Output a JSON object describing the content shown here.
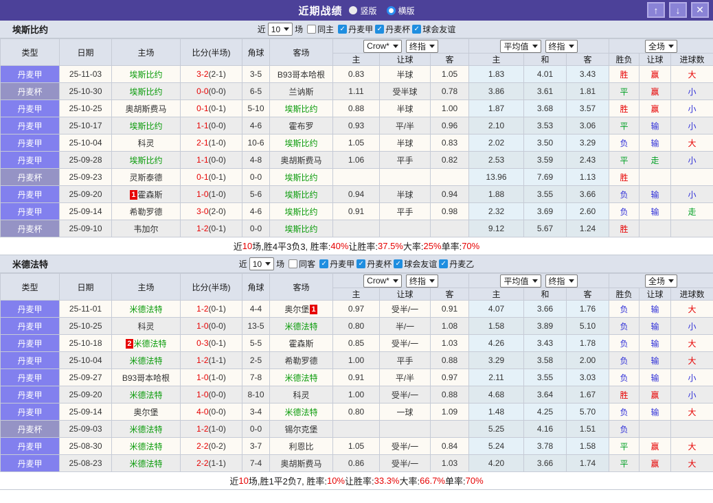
{
  "titlebar": {
    "title": "近期战绩",
    "radios": [
      {
        "label": "竖版",
        "selected": false
      },
      {
        "label": "横版",
        "selected": true
      }
    ],
    "icons": {
      "up": "↑",
      "down": "↓",
      "close": "✕"
    }
  },
  "labels": {
    "near": "近",
    "games": "场"
  },
  "selects": {
    "odds_source": "Crow*",
    "odds_mode": "终指",
    "avg_source": "平均值",
    "avg_mode": "终指",
    "scope": "全场"
  },
  "columns": {
    "type": "类型",
    "date": "日期",
    "home": "主场",
    "score": "比分(半场)",
    "corner": "角球",
    "away": "客场",
    "odds_home": "主",
    "odds_handicap": "让球",
    "odds_away": "客",
    "avg_home": "主",
    "avg_draw": "和",
    "avg_away": "客",
    "result": "胜负",
    "handicap_result": "让球",
    "goals": "进球数"
  },
  "sections": [
    {
      "team": "埃斯比约",
      "filter": {
        "count": "10",
        "same_label": "同主",
        "same_checked": false,
        "leagues": [
          "丹麦甲",
          "丹麦杯",
          "球会友谊"
        ]
      },
      "rows": [
        {
          "type": "丹麦甲",
          "cup": false,
          "date": "25-11-03",
          "home": "埃斯比约",
          "home_green": true,
          "home_badge": "",
          "ft": "3-2",
          "ht": "2-1",
          "corner": "3-5",
          "away": "B93哥本哈根",
          "away_green": false,
          "away_badge": "",
          "o1": "0.83",
          "o2": "半球",
          "o3": "1.05",
          "a1": "1.83",
          "a2": "4.01",
          "a3": "3.43",
          "res": "胜",
          "hres": "赢",
          "goal": "大"
        },
        {
          "type": "丹麦杯",
          "cup": true,
          "date": "25-10-30",
          "home": "埃斯比约",
          "home_green": true,
          "home_badge": "",
          "ft": "0-0",
          "ht": "0-0",
          "corner": "6-5",
          "away": "兰讷斯",
          "away_green": false,
          "away_badge": "",
          "o1": "1.11",
          "o2": "受半球",
          "o3": "0.78",
          "a1": "3.86",
          "a2": "3.61",
          "a3": "1.81",
          "res": "平",
          "hres": "赢",
          "goal": "小"
        },
        {
          "type": "丹麦甲",
          "cup": false,
          "date": "25-10-25",
          "home": "奥胡斯费马",
          "home_green": false,
          "home_badge": "",
          "ft": "0-1",
          "ht": "0-1",
          "corner": "5-10",
          "away": "埃斯比约",
          "away_green": true,
          "away_badge": "",
          "o1": "0.88",
          "o2": "半球",
          "o3": "1.00",
          "a1": "1.87",
          "a2": "3.68",
          "a3": "3.57",
          "res": "胜",
          "hres": "赢",
          "goal": "小"
        },
        {
          "type": "丹麦甲",
          "cup": false,
          "date": "25-10-17",
          "home": "埃斯比约",
          "home_green": true,
          "home_badge": "",
          "ft": "1-1",
          "ht": "0-0",
          "corner": "4-6",
          "away": "霍布罗",
          "away_green": false,
          "away_badge": "",
          "o1": "0.93",
          "o2": "平/半",
          "o3": "0.96",
          "a1": "2.10",
          "a2": "3.53",
          "a3": "3.06",
          "res": "平",
          "hres": "输",
          "goal": "小"
        },
        {
          "type": "丹麦甲",
          "cup": false,
          "date": "25-10-04",
          "home": "科灵",
          "home_green": false,
          "home_badge": "",
          "ft": "2-1",
          "ht": "1-0",
          "corner": "10-6",
          "away": "埃斯比约",
          "away_green": true,
          "away_badge": "",
          "o1": "1.05",
          "o2": "半球",
          "o3": "0.83",
          "a1": "2.02",
          "a2": "3.50",
          "a3": "3.29",
          "res": "负",
          "hres": "输",
          "goal": "大"
        },
        {
          "type": "丹麦甲",
          "cup": false,
          "date": "25-09-28",
          "home": "埃斯比约",
          "home_green": true,
          "home_badge": "",
          "ft": "1-1",
          "ht": "0-0",
          "corner": "4-8",
          "away": "奥胡斯费马",
          "away_green": false,
          "away_badge": "",
          "o1": "1.06",
          "o2": "平手",
          "o3": "0.82",
          "a1": "2.53",
          "a2": "3.59",
          "a3": "2.43",
          "res": "平",
          "hres": "走",
          "goal": "小"
        },
        {
          "type": "丹麦杯",
          "cup": true,
          "date": "25-09-23",
          "home": "灵斯泰德",
          "home_green": false,
          "home_badge": "",
          "ft": "0-1",
          "ht": "0-1",
          "corner": "0-0",
          "away": "埃斯比约",
          "away_green": true,
          "away_badge": "",
          "o1": "",
          "o2": "",
          "o3": "",
          "a1": "13.96",
          "a2": "7.69",
          "a3": "1.13",
          "res": "胜",
          "hres": "",
          "goal": ""
        },
        {
          "type": "丹麦甲",
          "cup": false,
          "date": "25-09-20",
          "home": "霍森斯",
          "home_green": false,
          "home_badge": "1",
          "ft": "1-0",
          "ht": "1-0",
          "corner": "5-6",
          "away": "埃斯比约",
          "away_green": true,
          "away_badge": "",
          "o1": "0.94",
          "o2": "半球",
          "o3": "0.94",
          "a1": "1.88",
          "a2": "3.55",
          "a3": "3.66",
          "res": "负",
          "hres": "输",
          "goal": "小"
        },
        {
          "type": "丹麦甲",
          "cup": false,
          "date": "25-09-14",
          "home": "希勒罗德",
          "home_green": false,
          "home_badge": "",
          "ft": "3-0",
          "ht": "2-0",
          "corner": "4-6",
          "away": "埃斯比约",
          "away_green": true,
          "away_badge": "",
          "o1": "0.91",
          "o2": "平手",
          "o3": "0.98",
          "a1": "2.32",
          "a2": "3.69",
          "a3": "2.60",
          "res": "负",
          "hres": "输",
          "goal": "走"
        },
        {
          "type": "丹麦杯",
          "cup": true,
          "date": "25-09-10",
          "home": "韦加尔",
          "home_green": false,
          "home_badge": "",
          "ft": "1-2",
          "ht": "0-1",
          "corner": "0-0",
          "away": "埃斯比约",
          "away_green": true,
          "away_badge": "",
          "o1": "",
          "o2": "",
          "o3": "",
          "a1": "9.12",
          "a2": "5.67",
          "a3": "1.24",
          "res": "胜",
          "hres": "",
          "goal": ""
        }
      ],
      "summary": [
        {
          "t": "近"
        },
        {
          "t": "10",
          "red": true
        },
        {
          "t": "场,胜4平3负3, 胜率:"
        },
        {
          "t": "40%",
          "red": true
        },
        {
          "t": " 让胜率:"
        },
        {
          "t": "37.5%",
          "red": true
        },
        {
          "t": " 大率:"
        },
        {
          "t": "25%",
          "red": true
        },
        {
          "t": " 单率:"
        },
        {
          "t": "70%",
          "red": true
        }
      ]
    },
    {
      "team": "米德法特",
      "filter": {
        "count": "10",
        "same_label": "同客",
        "same_checked": false,
        "leagues": [
          "丹麦甲",
          "丹麦杯",
          "球会友谊",
          "丹麦乙"
        ]
      },
      "rows": [
        {
          "type": "丹麦甲",
          "cup": false,
          "date": "25-11-01",
          "home": "米德法特",
          "home_green": true,
          "home_badge": "",
          "ft": "1-2",
          "ht": "0-1",
          "corner": "4-4",
          "away": "奥尔堡",
          "away_green": false,
          "away_badge": "1",
          "o1": "0.97",
          "o2": "受半/一",
          "o3": "0.91",
          "a1": "4.07",
          "a2": "3.66",
          "a3": "1.76",
          "res": "负",
          "hres": "输",
          "goal": "大"
        },
        {
          "type": "丹麦甲",
          "cup": false,
          "date": "25-10-25",
          "home": "科灵",
          "home_green": false,
          "home_badge": "",
          "ft": "1-0",
          "ht": "0-0",
          "corner": "13-5",
          "away": "米德法特",
          "away_green": true,
          "away_badge": "",
          "o1": "0.80",
          "o2": "半/一",
          "o3": "1.08",
          "a1": "1.58",
          "a2": "3.89",
          "a3": "5.10",
          "res": "负",
          "hres": "输",
          "goal": "小"
        },
        {
          "type": "丹麦甲",
          "cup": false,
          "date": "25-10-18",
          "home": "米德法特",
          "home_green": true,
          "home_badge": "2",
          "ft": "0-3",
          "ht": "0-1",
          "corner": "5-5",
          "away": "霍森斯",
          "away_green": false,
          "away_badge": "",
          "o1": "0.85",
          "o2": "受半/一",
          "o3": "1.03",
          "a1": "4.26",
          "a2": "3.43",
          "a3": "1.78",
          "res": "负",
          "hres": "输",
          "goal": "大"
        },
        {
          "type": "丹麦甲",
          "cup": false,
          "date": "25-10-04",
          "home": "米德法特",
          "home_green": true,
          "home_badge": "",
          "ft": "1-2",
          "ht": "1-1",
          "corner": "2-5",
          "away": "希勒罗德",
          "away_green": false,
          "away_badge": "",
          "o1": "1.00",
          "o2": "平手",
          "o3": "0.88",
          "a1": "3.29",
          "a2": "3.58",
          "a3": "2.00",
          "res": "负",
          "hres": "输",
          "goal": "大"
        },
        {
          "type": "丹麦甲",
          "cup": false,
          "date": "25-09-27",
          "home": "B93哥本哈根",
          "home_green": false,
          "home_badge": "",
          "ft": "1-0",
          "ht": "1-0",
          "corner": "7-8",
          "away": "米德法特",
          "away_green": true,
          "away_badge": "",
          "o1": "0.91",
          "o2": "平/半",
          "o3": "0.97",
          "a1": "2.11",
          "a2": "3.55",
          "a3": "3.03",
          "res": "负",
          "hres": "输",
          "goal": "小"
        },
        {
          "type": "丹麦甲",
          "cup": false,
          "date": "25-09-20",
          "home": "米德法特",
          "home_green": true,
          "home_badge": "",
          "ft": "1-0",
          "ht": "0-0",
          "corner": "8-10",
          "away": "科灵",
          "away_green": false,
          "away_badge": "",
          "o1": "1.00",
          "o2": "受半/一",
          "o3": "0.88",
          "a1": "4.68",
          "a2": "3.64",
          "a3": "1.67",
          "res": "胜",
          "hres": "赢",
          "goal": "小"
        },
        {
          "type": "丹麦甲",
          "cup": false,
          "date": "25-09-14",
          "home": "奥尔堡",
          "home_green": false,
          "home_badge": "",
          "ft": "4-0",
          "ht": "0-0",
          "corner": "3-4",
          "away": "米德法特",
          "away_green": true,
          "away_badge": "",
          "o1": "0.80",
          "o2": "一球",
          "o3": "1.09",
          "a1": "1.48",
          "a2": "4.25",
          "a3": "5.70",
          "res": "负",
          "hres": "输",
          "goal": "大"
        },
        {
          "type": "丹麦杯",
          "cup": true,
          "date": "25-09-03",
          "home": "米德法特",
          "home_green": true,
          "home_badge": "",
          "ft": "1-2",
          "ht": "1-0",
          "corner": "0-0",
          "away": "锡尔克堡",
          "away_green": false,
          "away_badge": "",
          "o1": "",
          "o2": "",
          "o3": "",
          "a1": "5.25",
          "a2": "4.16",
          "a3": "1.51",
          "res": "负",
          "hres": "",
          "goal": ""
        },
        {
          "type": "丹麦甲",
          "cup": false,
          "date": "25-08-30",
          "home": "米德法特",
          "home_green": true,
          "home_badge": "",
          "ft": "2-2",
          "ht": "0-2",
          "corner": "3-7",
          "away": "利恩比",
          "away_green": false,
          "away_badge": "",
          "o1": "1.05",
          "o2": "受半/一",
          "o3": "0.84",
          "a1": "5.24",
          "a2": "3.78",
          "a3": "1.58",
          "res": "平",
          "hres": "赢",
          "goal": "大"
        },
        {
          "type": "丹麦甲",
          "cup": false,
          "date": "25-08-23",
          "home": "米德法特",
          "home_green": true,
          "home_badge": "",
          "ft": "2-2",
          "ht": "1-1",
          "corner": "7-4",
          "away": "奥胡斯费马",
          "away_green": false,
          "away_badge": "",
          "o1": "0.86",
          "o2": "受半/一",
          "o3": "1.03",
          "a1": "4.20",
          "a2": "3.66",
          "a3": "1.74",
          "res": "平",
          "hres": "赢",
          "goal": "大"
        }
      ],
      "summary": [
        {
          "t": "近"
        },
        {
          "t": "10",
          "red": true
        },
        {
          "t": "场,胜1平2负7, 胜率:"
        },
        {
          "t": "10%",
          "red": true
        },
        {
          "t": " 让胜率:"
        },
        {
          "t": "33.3%",
          "red": true
        },
        {
          "t": " 大率:"
        },
        {
          "t": "66.7%",
          "red": true
        },
        {
          "t": " 单率:"
        },
        {
          "t": "70%",
          "red": true
        }
      ]
    }
  ]
}
